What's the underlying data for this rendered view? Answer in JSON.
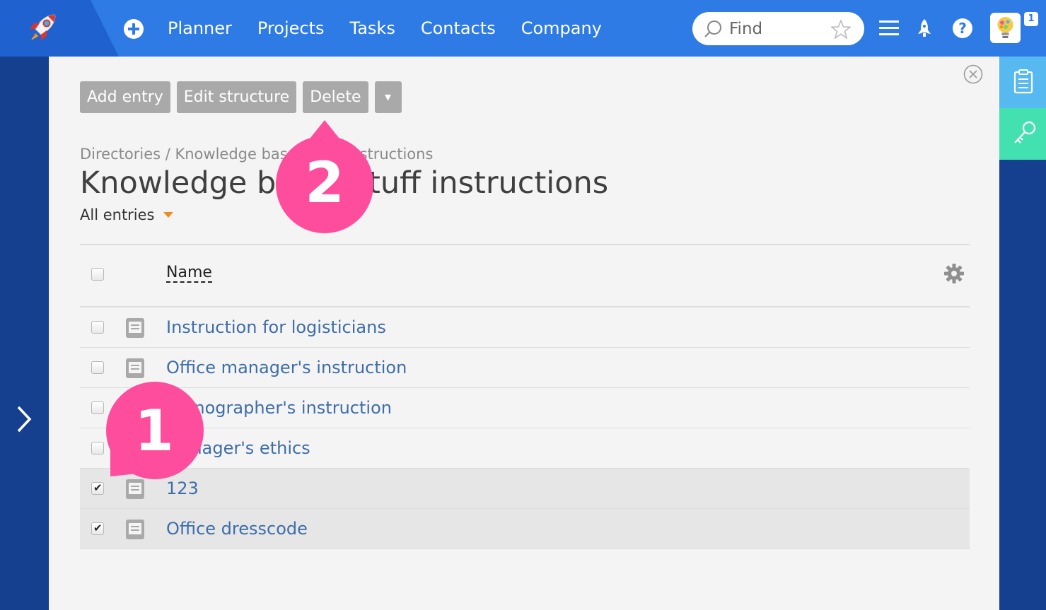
{
  "topbar": {
    "nav": [
      "Planner",
      "Projects",
      "Tasks",
      "Contacts",
      "Company"
    ],
    "search_placeholder": "Find",
    "notification_count": "1"
  },
  "toolbar": {
    "add_entry": "Add entry",
    "edit_structure": "Edit structure",
    "delete": "Delete",
    "more": "▾"
  },
  "breadcrumb": "Directories / Knowledge base: Stuff instructions",
  "page_title": "Knowledge base: Stuff instructions",
  "filter": "All entries",
  "table": {
    "column_name": "Name",
    "rows": [
      {
        "name": "Instruction for logisticians",
        "checked": false
      },
      {
        "name": "Office manager's instruction",
        "checked": false
      },
      {
        "name": "Stenographer's instruction",
        "checked": false
      },
      {
        "name": "Manager's ethics",
        "checked": false
      },
      {
        "name": "123",
        "checked": true
      },
      {
        "name": "Office dresscode",
        "checked": true
      }
    ]
  },
  "annotations": {
    "callout_1": "1",
    "callout_2": "2",
    "color": "#ff4d9d"
  },
  "colors": {
    "topbar": "#2e7be6",
    "sidebar": "#15408f",
    "link": "#3e6da8",
    "button": "#a9a9a9",
    "rail_notes": "#56b9ef",
    "rail_key": "#43e1b0"
  }
}
